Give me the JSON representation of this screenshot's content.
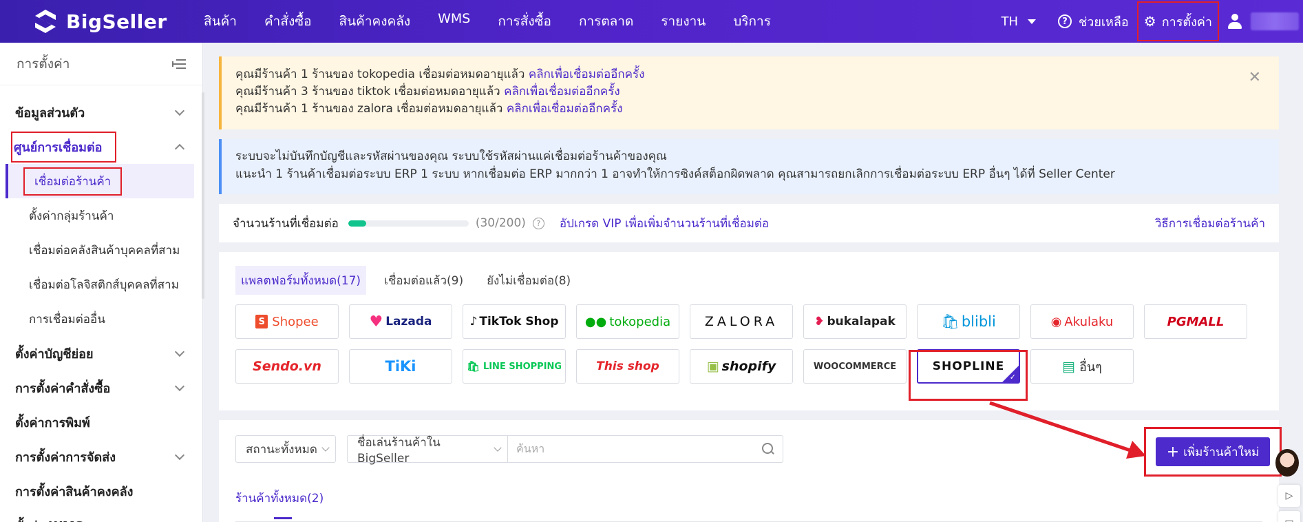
{
  "app": {
    "logo_text": "BigSeller",
    "nav": [
      "สินค้า",
      "คำสั่งซื้อ",
      "สินค้าคงคลัง",
      "WMS",
      "การสั่งซื้อ",
      "การตลาด",
      "รายงาน",
      "บริการ"
    ],
    "lang": "TH",
    "help_label": "ช่วยเหลือ",
    "settings_label": "การตั้งค่า",
    "accent": "#4c2acb",
    "highlight": "#e01f2a"
  },
  "sidebar": {
    "title": "การตั้งค่า",
    "items": [
      {
        "label": "ข้อมูลส่วนตัว"
      },
      {
        "label": "ศูนย์การเชื่อมต่อ"
      },
      {
        "label": "ตั้งค่าบัญชีย่อย"
      },
      {
        "label": "การตั้งค่าคำสั่งซื้อ"
      },
      {
        "label": "ตั้งค่าการพิมพ์"
      },
      {
        "label": "การตั้งค่าการจัดส่ง"
      },
      {
        "label": "การตั้งค่าสินค้าคงคลัง"
      },
      {
        "label": "ตั้งค่า WMS"
      }
    ],
    "subitems": [
      "เชื่อมต่อร้านค้า",
      "ตั้งค่ากลุ่มร้านค้า",
      "เชื่อมต่อคลังสินค้าบุคคลที่สาม",
      "เชื่อมต่อโลจิสติกส์บุคคลที่สาม",
      "การเชื่อมต่ออื่น"
    ]
  },
  "warning": {
    "lines": [
      {
        "text": "คุณมีร้านค้า 1 ร้านของ tokopedia เชื่อมต่อหมดอายุแล้ว",
        "link": "คลิกเพื่อเชื่อมต่ออีกครั้ง"
      },
      {
        "text": "คุณมีร้านค้า 3 ร้านของ tiktok เชื่อมต่อหมดอายุแล้ว",
        "link": "คลิกเพื่อเชื่อมต่ออีกครั้ง"
      },
      {
        "text": "คุณมีร้านค้า 1 ร้านของ zalora เชื่อมต่อหมดอายุแล้ว",
        "link": "คลิกเพื่อเชื่อมต่ออีกครั้ง"
      }
    ]
  },
  "info": {
    "line1": "ระบบจะไม่บันทึกบัญชีและรหัสผ่านของคุณ ระบบใช้รหัสผ่านแค่เชื่อมต่อร้านค้าของคุณ",
    "line2": "แนะนำ 1 ร้านค้าเชื่อมต่อระบบ ERP 1 ระบบ หากเชื่อมต่อ ERP มากกว่า 1 อาจทำให้การซิงค์สต็อกผิดพลาด คุณสามารถยกเลิกการเชื่อมต่อระบบ ERP อื่นๆ ได้ที่ Seller Center"
  },
  "connection": {
    "label": "จำนวนร้านที่เชื่อมต่อ",
    "count_text": "(30/200)",
    "progress": 0.15,
    "upgrade_link": "อัปเกรด VIP เพื่อเพิ่มจำนวนร้านที่เชื่อมต่อ",
    "howto_link": "วิธีการเชื่อมต่อร้านค้า"
  },
  "platform_tabs": [
    "แพลตฟอร์มทั้งหมด(17)",
    "เชื่อมต่อแล้ว(9)",
    "ยังไม่เชื่อมต่อ(8)"
  ],
  "platforms": [
    "Shopee",
    "Lazada",
    "TikTok Shop",
    "tokopedia",
    "ZALORA",
    "bukalapak",
    "blibli",
    "Akulaku",
    "PGMALL",
    "Sendo.vn",
    "TiKi",
    "LINE SHOPPING",
    "This shop",
    "shopify",
    "WOOCOMMERCE",
    "SHOPLINE",
    "อื่นๆ"
  ],
  "store_filters": {
    "status": "สถานะทั้งหมด",
    "name_field": "ชื่อเล่นร้านค้าใน BigSeller",
    "search_placeholder": "ค้นหา",
    "add_button": "เพิ่มร้านค้าใหม่"
  },
  "store_tabs": [
    "ร้านค้าทั้งหมด(2)"
  ]
}
